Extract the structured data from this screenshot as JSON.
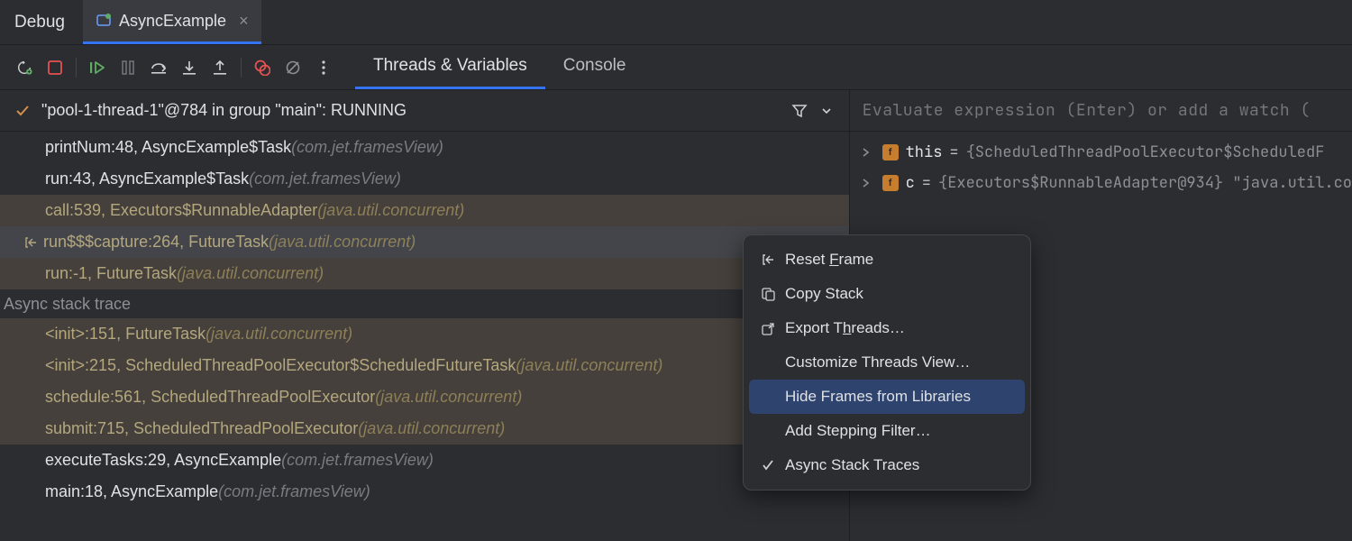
{
  "title": "Debug",
  "tab": {
    "label": "AsyncExample"
  },
  "contentTabs": {
    "threads": "Threads & Variables",
    "console": "Console"
  },
  "threadHeader": "\"pool-1-thread-1\"@784 in group \"main\": RUNNING",
  "frames": [
    {
      "text": "printNum:48, AsyncExample$Task ",
      "pkg": "(com.jet.framesView)",
      "lib": false
    },
    {
      "text": "run:43, AsyncExample$Task ",
      "pkg": "(com.jet.framesView)",
      "lib": false
    },
    {
      "text": "call:539, Executors$RunnableAdapter ",
      "pkg": "(java.util.concurrent)",
      "lib": true
    },
    {
      "text": "run$$$capture:264, FutureTask ",
      "pkg": "(java.util.concurrent)",
      "lib": true,
      "selected": true
    },
    {
      "text": "run:-1, FutureTask ",
      "pkg": "(java.util.concurrent)",
      "lib": true
    }
  ],
  "asyncLabel": "Async stack trace",
  "asyncFrames": [
    {
      "text": "<init>:151, FutureTask ",
      "pkg": "(java.util.concurrent)",
      "lib": true
    },
    {
      "text": "<init>:215, ScheduledThreadPoolExecutor$ScheduledFutureTask ",
      "pkg": "(java.util.concurrent)",
      "lib": true
    },
    {
      "text": "schedule:561, ScheduledThreadPoolExecutor ",
      "pkg": "(java.util.concurrent)",
      "lib": true
    },
    {
      "text": "submit:715, ScheduledThreadPoolExecutor ",
      "pkg": "(java.util.concurrent)",
      "lib": true
    },
    {
      "text": "executeTasks:29, AsyncExample ",
      "pkg": "(com.jet.framesView)",
      "lib": false
    },
    {
      "text": "main:18, AsyncExample ",
      "pkg": "(com.jet.framesView)",
      "lib": false
    }
  ],
  "evalPlaceholder": "Evaluate expression (Enter) or add a watch (",
  "vars": [
    {
      "name": "this",
      "val": "{ScheduledThreadPoolExecutor$ScheduledF"
    },
    {
      "name": "c",
      "val": "{Executors$RunnableAdapter@934} \"java.util.co"
    }
  ],
  "menu": {
    "resetFrame": {
      "pre": "Reset ",
      "ul": "F",
      "post": "rame"
    },
    "copyStack": "Copy Stack",
    "exportThreads": {
      "pre": "Export T",
      "ul": "h",
      "post": "reads…"
    },
    "customize": "Customize Threads View…",
    "hideLibs": "Hide Frames from Libraries",
    "addFilter": "Add Stepping Filter…",
    "asyncTraces": "Async Stack Traces"
  }
}
